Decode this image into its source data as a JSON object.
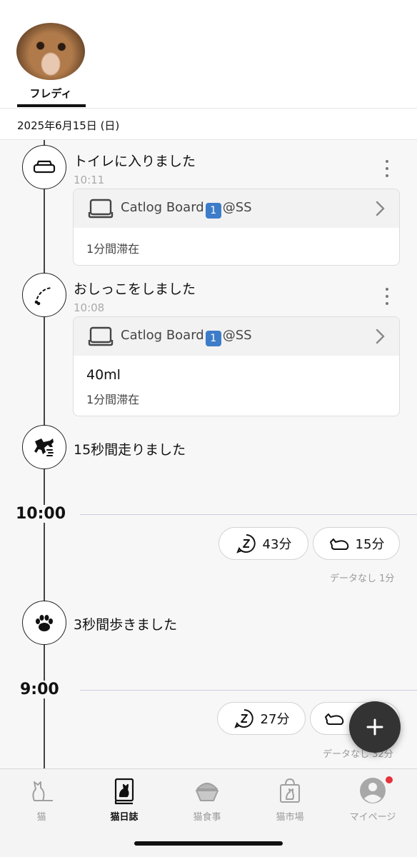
{
  "header": {
    "cat_name": "フレディ"
  },
  "date_label": "2025年6月15日 (日)",
  "events": [
    {
      "title": "トイレに入りました",
      "time": "10:11",
      "device": "Catlog Board",
      "device_badge": "1",
      "device_suffix": "@SS",
      "stay": "1分間滞在"
    },
    {
      "title": "おしっこをしました",
      "time": "10:08",
      "device": "Catlog Board",
      "device_badge": "1",
      "device_suffix": "@SS",
      "amount": "40ml",
      "stay": "1分間滞在"
    },
    {
      "title": "15秒間走りました"
    },
    {
      "title": "3秒間歩きました"
    }
  ],
  "hours": [
    {
      "label": "10:00",
      "sleep": "43分",
      "rest": "15分",
      "nodata": "データなし 1分"
    },
    {
      "label": "9:00",
      "sleep": "27分",
      "rest": "",
      "nodata": "データなし 32分"
    }
  ],
  "tabs": [
    {
      "label": "猫",
      "icon": "cat-icon"
    },
    {
      "label": "猫日誌",
      "icon": "diary-icon"
    },
    {
      "label": "猫食事",
      "icon": "food-bowl-icon"
    },
    {
      "label": "猫市場",
      "icon": "shopping-bag-icon"
    },
    {
      "label": "マイページ",
      "icon": "profile-icon"
    }
  ],
  "colors": {
    "accent": "#333333",
    "badge": "#e5323b",
    "device_badge": "#3d7cc9"
  }
}
